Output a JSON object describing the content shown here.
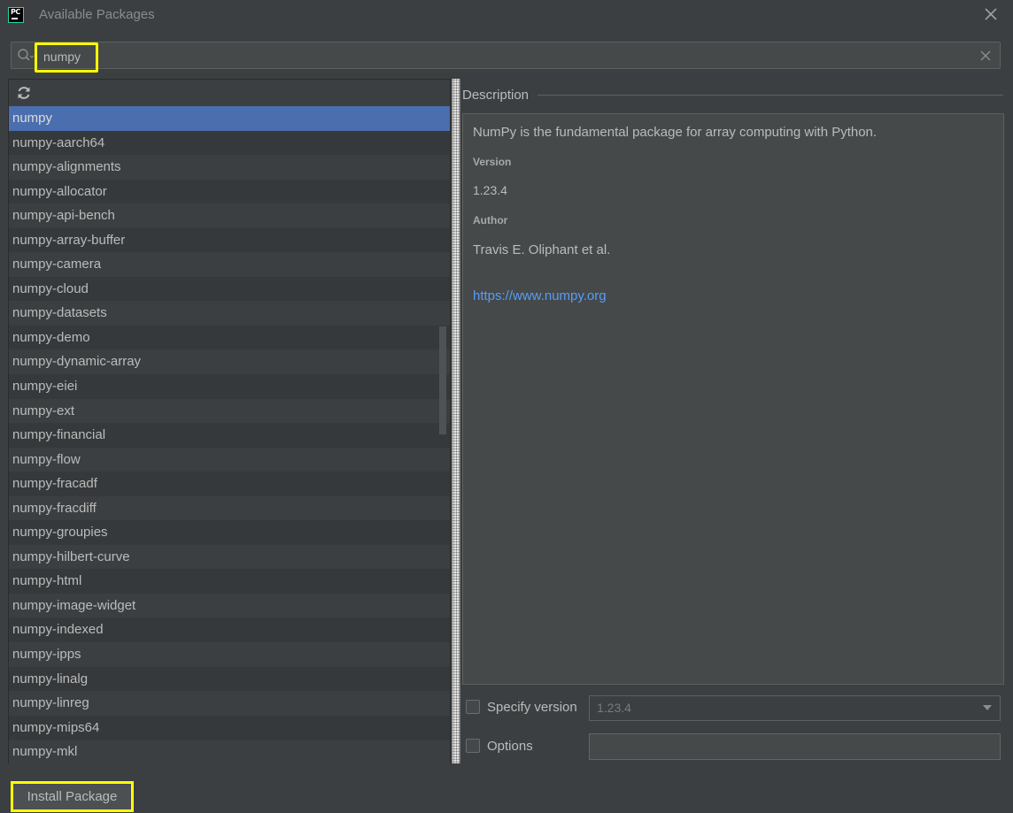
{
  "window": {
    "title": "Available Packages",
    "icon": "pycharm-logo",
    "icon_text": "PC"
  },
  "search": {
    "value": "numpy",
    "placeholder": "",
    "highlight_color": "#ffff00"
  },
  "packages": {
    "selected": "numpy",
    "items": [
      "numpy",
      "numpy-aarch64",
      "numpy-alignments",
      "numpy-allocator",
      "numpy-api-bench",
      "numpy-array-buffer",
      "numpy-camera",
      "numpy-cloud",
      "numpy-datasets",
      "numpy-demo",
      "numpy-dynamic-array",
      "numpy-eiei",
      "numpy-ext",
      "numpy-financial",
      "numpy-flow",
      "numpy-fracadf",
      "numpy-fracdiff",
      "numpy-groupies",
      "numpy-hilbert-curve",
      "numpy-html",
      "numpy-image-widget",
      "numpy-indexed",
      "numpy-ipps",
      "numpy-linalg",
      "numpy-linreg",
      "numpy-mips64",
      "numpy-mkl"
    ]
  },
  "description": {
    "section_title": "Description",
    "text": "NumPy is the fundamental package for array computing with Python.",
    "version_label": "Version",
    "version": "1.23.4",
    "author_label": "Author",
    "author": "Travis E. Oliphant et al.",
    "homepage": "https://www.numpy.org"
  },
  "options": {
    "specify_version_label": "Specify version",
    "specify_version_checked": false,
    "version_select_value": "1.23.4",
    "options_label": "Options",
    "options_checked": false,
    "options_value": ""
  },
  "footer": {
    "install_label": "Install Package"
  },
  "colors": {
    "background": "#3c3f41",
    "selection": "#4b6eaf",
    "link": "#589df6",
    "highlight": "#ffff00"
  }
}
